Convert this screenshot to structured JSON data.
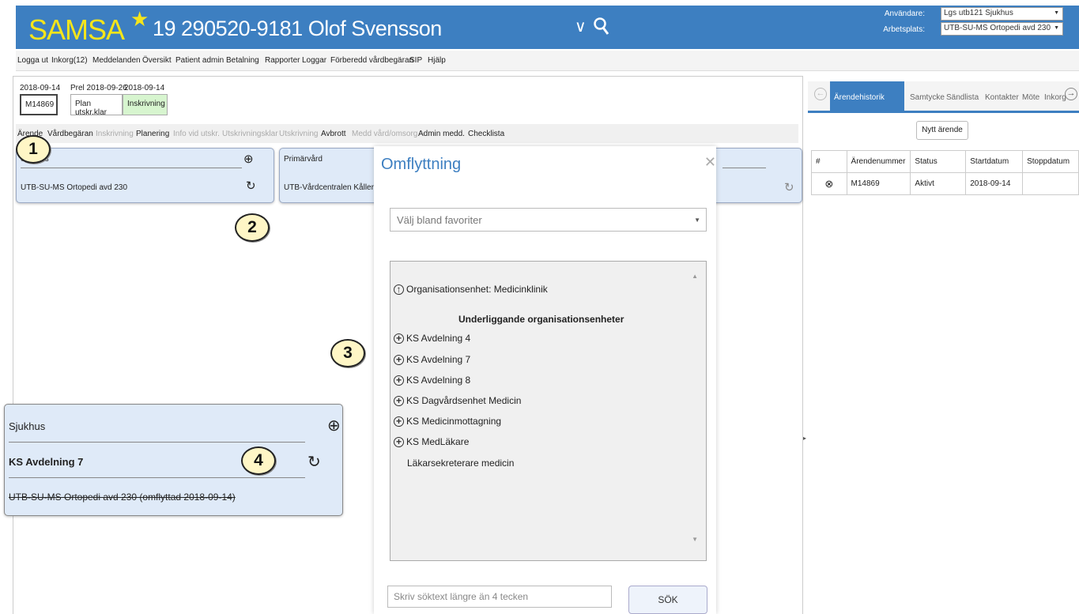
{
  "header": {
    "app_name": "SAMSA",
    "patient": "19 290520-9181 Olof  Svensson",
    "user_label": "Användare:",
    "user_value": "Lgs utb121 Sjukhus",
    "workplace_label": "Arbetsplats:",
    "workplace_value": "UTB-SU-MS Ortopedi avd 230",
    "colors": {
      "bar": "#3d7fc1",
      "logo": "#f5e51b"
    }
  },
  "menu": [
    "Logga ut",
    "Inkorg(12)",
    "Meddelanden",
    "Översikt",
    "Patient admin",
    "Betalning",
    "Rapporter",
    "Loggar",
    "Förberedd vårdbegäran",
    "SIP",
    "Hjälp"
  ],
  "case": {
    "date": "2018-09-14",
    "id": "M14869",
    "prel": "Prel 2018-09-26",
    "date2": "2018-09-14",
    "plan": "Plan utskr.klar",
    "inskrivning": "Inskrivning"
  },
  "tabs": [
    "Ärende",
    "Vårdbegäran",
    "Inskrivning",
    "Planering",
    "Info vid utskr.",
    "Utskrivningsklar",
    "Utskrivning",
    "Avbrott",
    "Medd vård/omsorg",
    "Admin medd.",
    "Checklista"
  ],
  "cards": {
    "hospital_label": "Sjukhus",
    "hospital_unit": "UTB-SU-MS Ortopedi avd 230",
    "primary_label": "Primärvård",
    "primary_unit": "UTB-Vårdcentralen Kållered"
  },
  "zoom_card": {
    "label": "Sjukhus",
    "unit": "KS Avdelning 7",
    "old_unit": "UTB-SU-MS Ortopedi avd 230 (omflyttad 2018-09-14)"
  },
  "badges": [
    "1",
    "2",
    "3",
    "4"
  ],
  "modal": {
    "title": "Omflyttning",
    "favorites_placeholder": "Välj bland favoriter",
    "org_parent": "Organisationsenhet: Medicinklinik",
    "sub_heading": "Underliggande organisationsenheter",
    "units": [
      "KS Avdelning 4",
      "KS Avdelning 7",
      "KS Avdelning 8",
      "KS Dagvårdsenhet Medicin",
      "KS Medicinmottagning",
      "KS MedLäkare"
    ],
    "leaf": "Läkarsekreterare medicin",
    "search_placeholder": "Skriv söktext längre än 4 tecken",
    "search_button": "SÖK"
  },
  "right": {
    "tabs": [
      "Ärendehistorik",
      "Samtycke",
      "Sändlista",
      "Kontakter",
      "Möte",
      "Inkorg"
    ],
    "new_case": "Nytt ärende",
    "columns": [
      "#",
      "Ärendenummer",
      "Status",
      "Startdatum",
      "Stoppdatum"
    ],
    "rows": [
      {
        "num": "M14869",
        "status": "Aktivt",
        "start": "2018-09-14",
        "stop": ""
      }
    ]
  }
}
